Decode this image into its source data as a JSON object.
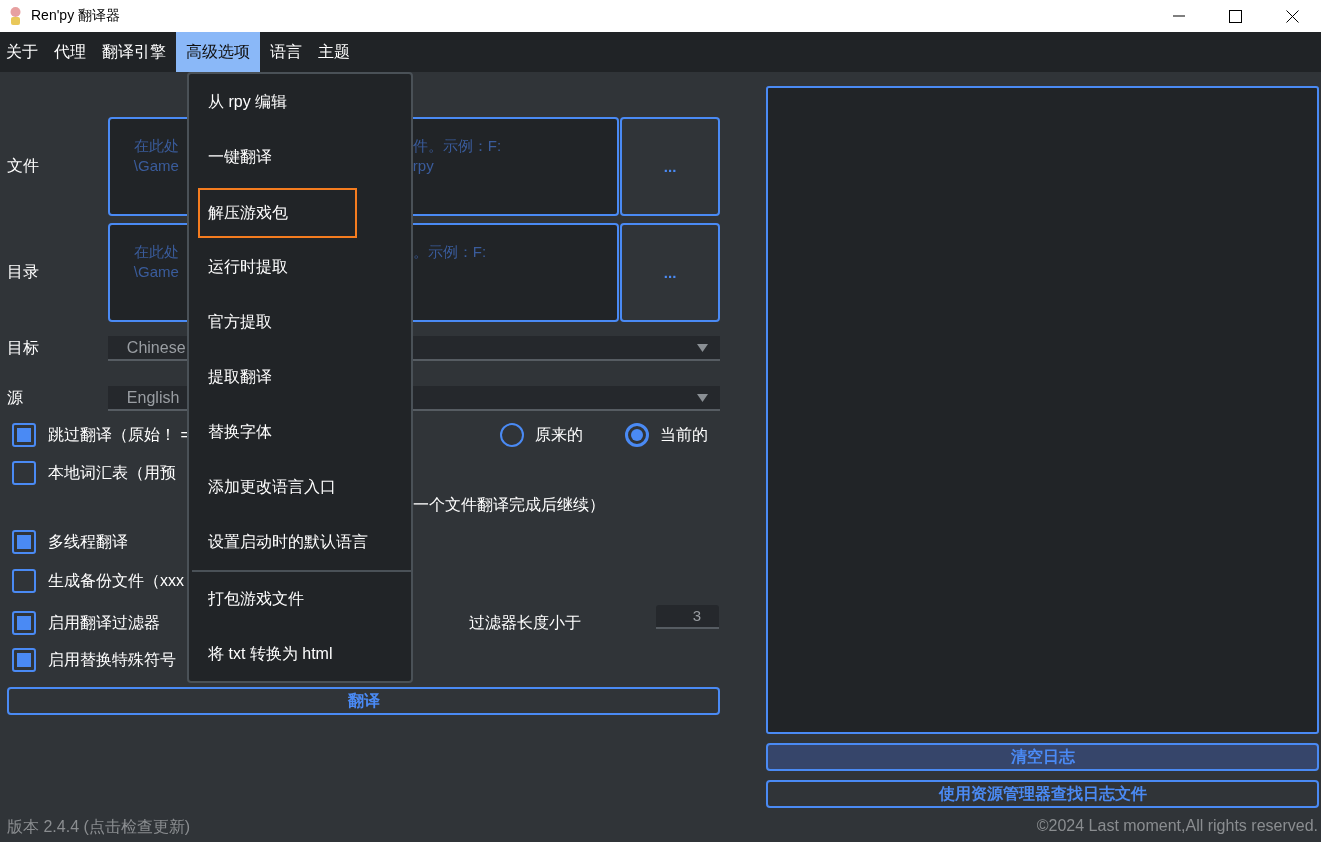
{
  "window": {
    "title": "Ren'py 翻译器"
  },
  "menu_bar": [
    {
      "label": "关于",
      "selected": false
    },
    {
      "label": "代理",
      "selected": false
    },
    {
      "label": "翻译引擎",
      "selected": false
    },
    {
      "label": "高级选项",
      "selected": true
    },
    {
      "label": "语言",
      "selected": false
    },
    {
      "label": "主题",
      "selected": false
    }
  ],
  "form": {
    "path_fields": [
      {
        "label": "文件",
        "hint_left": [
          "在此处",
          "\\Game"
        ],
        "hint_right": [
          "件。示例：F:",
          "rpy"
        ],
        "browse_button": "..."
      },
      {
        "label": "目录",
        "hint_left": [
          "在此处",
          "\\Game"
        ],
        "hint_right": [
          "。示例：F:"
        ],
        "browse_button": "..."
      }
    ],
    "selects": [
      {
        "label": "目标",
        "value": "Chinese"
      },
      {
        "label": "源",
        "value": "English"
      }
    ],
    "options": [
      {
        "kind": "checkbox",
        "label": "跳过翻译（原始！ =",
        "checked": true,
        "radios": [
          {
            "label": "原来的",
            "selected": false
          },
          {
            "label": "当前的",
            "selected": true
          }
        ]
      },
      {
        "kind": "checkbox",
        "label": "本地词汇表（用预",
        "checked": false
      },
      {
        "kind": "continuation",
        "label": "一个文件翻译完成后继续）"
      },
      {
        "kind": "checkbox",
        "label": "多线程翻译",
        "checked": true
      },
      {
        "kind": "checkbox",
        "label": "生成备份文件（xxx",
        "checked": false
      },
      {
        "kind": "checkbox",
        "label": "启用翻译过滤器",
        "checked": true,
        "filter": {
          "label": "过滤器长度小于",
          "value": "3"
        }
      },
      {
        "kind": "checkbox",
        "label": "启用替换特殊符号",
        "checked": true
      }
    ],
    "translate_button": "翻译"
  },
  "log_panel": {
    "buttons": [
      {
        "label": "清空日志",
        "kind": "filled"
      },
      {
        "label": "使用资源管理器查找日志文件",
        "kind": "outline"
      }
    ]
  },
  "footer": {
    "version": "版本 2.4.4 (点击检查更新)",
    "copyright": "©2024 Last moment,All rights reserved."
  },
  "dropdown": {
    "items": [
      {
        "kind": "item",
        "label": "从 rpy 编辑",
        "highlighted": false
      },
      {
        "kind": "item",
        "label": "一键翻译",
        "highlighted": false
      },
      {
        "kind": "item",
        "label": "解压游戏包",
        "highlighted": true
      },
      {
        "kind": "item",
        "label": "运行时提取",
        "highlighted": false
      },
      {
        "kind": "item",
        "label": "官方提取",
        "highlighted": false
      },
      {
        "kind": "item",
        "label": "提取翻译",
        "highlighted": false
      },
      {
        "kind": "item",
        "label": "替换字体",
        "highlighted": false
      },
      {
        "kind": "item",
        "label": "添加更改语言入口",
        "highlighted": false
      },
      {
        "kind": "item",
        "label": "设置启动时的默认语言",
        "highlighted": false
      },
      {
        "kind": "separator"
      },
      {
        "kind": "item",
        "label": "打包游戏文件",
        "highlighted": false
      },
      {
        "kind": "item",
        "label": "将 txt 转换为 html",
        "highlighted": false
      }
    ]
  }
}
